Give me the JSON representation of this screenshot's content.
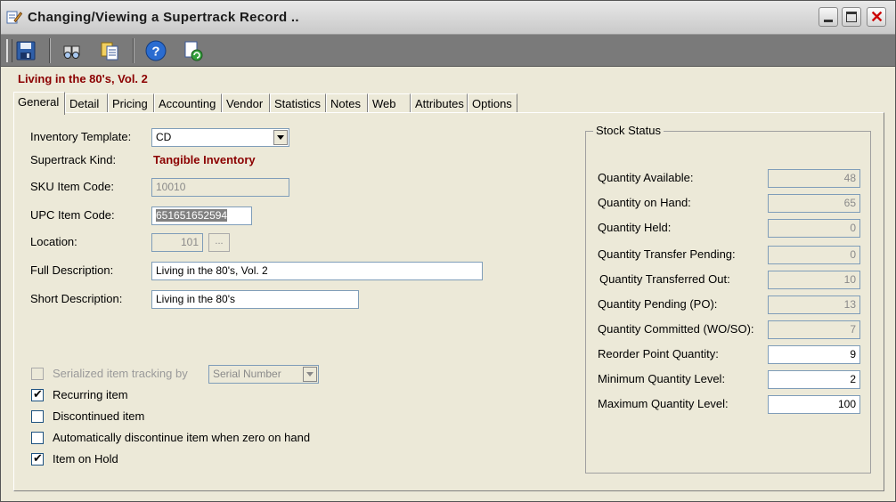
{
  "window": {
    "title": "Changing/Viewing a Supertrack Record ..",
    "icon": "edit-record-icon"
  },
  "toolbar": {
    "buttons": [
      {
        "name": "save-icon"
      },
      {
        "name": "find-icon"
      },
      {
        "name": "copy-icon"
      },
      {
        "name": "help-icon"
      },
      {
        "name": "refresh-icon"
      }
    ]
  },
  "record": {
    "title": "Living in the 80's, Vol. 2"
  },
  "tabs": [
    {
      "label": "General",
      "active": true
    },
    {
      "label": "Detail"
    },
    {
      "label": "Pricing"
    },
    {
      "label": "Accounting"
    },
    {
      "label": "Vendor"
    },
    {
      "label": "Statistics"
    },
    {
      "label": "Notes"
    },
    {
      "label": "Web"
    },
    {
      "label": "Attributes"
    },
    {
      "label": "Options"
    }
  ],
  "general": {
    "inventory_template": {
      "label": "Inventory Template:",
      "value": "CD"
    },
    "supertrack_kind": {
      "label": "Supertrack Kind:",
      "value": "Tangible Inventory"
    },
    "sku": {
      "label": "SKU Item Code:",
      "value": "10010"
    },
    "upc": {
      "label": "UPC Item Code:",
      "value": "651651652594"
    },
    "location": {
      "label": "Location:",
      "value": "101",
      "browse": "..."
    },
    "full_description": {
      "label": "Full Description:",
      "value": "Living in the 80's, Vol. 2"
    },
    "short_description": {
      "label": "Short Description:",
      "value": "Living in the 80's"
    },
    "serialized": {
      "label": "Serialized item tracking by",
      "checked": false,
      "option": "Serial Number"
    },
    "recurring": {
      "label": "Recurring item",
      "checked": true
    },
    "discontinued": {
      "label": "Discontinued item",
      "checked": false
    },
    "auto_discontinue": {
      "label": "Automatically discontinue item when zero on hand",
      "checked": false
    },
    "on_hold": {
      "label": "Item on Hold",
      "checked": true
    }
  },
  "stock_status": {
    "title": "Stock Status",
    "rows": [
      {
        "label": "Quantity Available:",
        "value": "48",
        "editable": false
      },
      {
        "label": "Quantity on Hand:",
        "value": "65",
        "editable": false
      },
      {
        "label": "Quantity Held:",
        "value": "0",
        "editable": false
      },
      {
        "label": "Quantity Transfer Pending:",
        "value": "0",
        "editable": false
      },
      {
        "label": "Quantity Transferred Out:",
        "value": "10",
        "editable": false
      },
      {
        "label": "Quantity Pending (PO):",
        "value": "13",
        "editable": false
      },
      {
        "label": "Quantity Committed (WO/SO):",
        "value": "7",
        "editable": false
      },
      {
        "label": "Reorder Point Quantity:",
        "value": "9",
        "editable": true
      },
      {
        "label": "Minimum Quantity Level:",
        "value": "2",
        "editable": true
      },
      {
        "label": "Maximum Quantity Level:",
        "value": "100",
        "editable": true
      }
    ]
  },
  "check_mark": "✔",
  "colors": {
    "record_title": "#8b0000",
    "kind_value": "#8b0000",
    "toolbar_bg": "#7a7a7a"
  }
}
